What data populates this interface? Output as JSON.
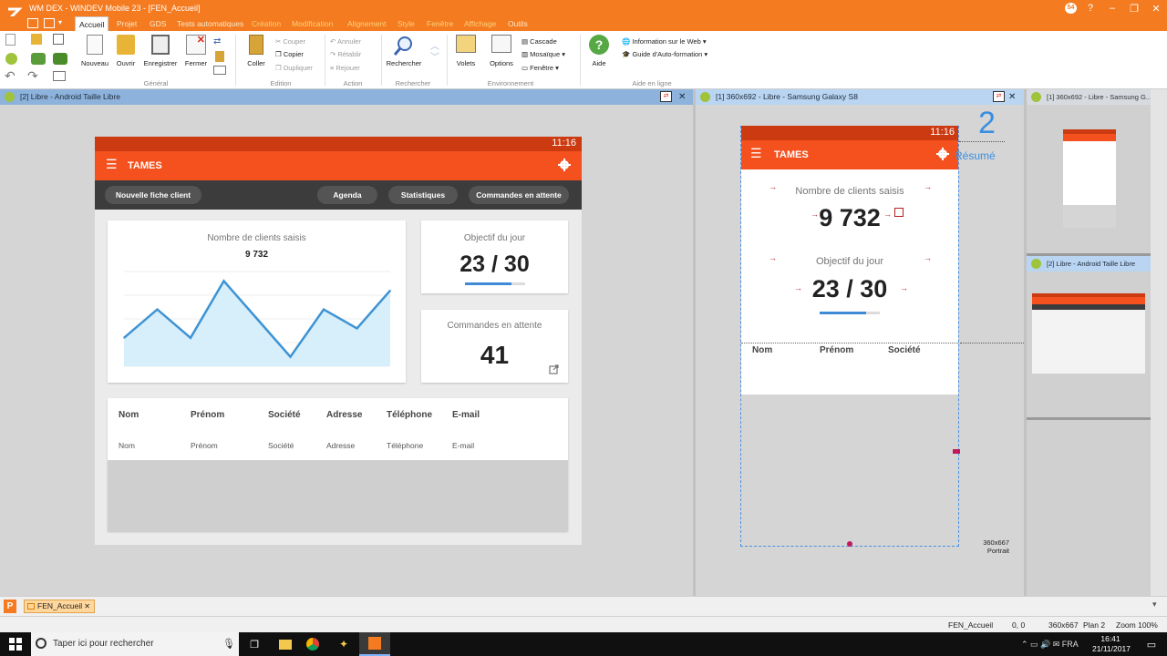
{
  "window": {
    "title": "WM DEX - WINDEV Mobile 23 - [FEN_Accueil]",
    "user_badge": "54",
    "controls": [
      "?",
      "–",
      "❐",
      "✕"
    ]
  },
  "menu_tabs": [
    "Accueil",
    "Projet",
    "GDS",
    "Tests automatiques",
    "Création",
    "Modification",
    "Alignement",
    "Style",
    "Fenêtre",
    "Affichage",
    "Outils"
  ],
  "ribbon": {
    "general": {
      "nouveau": "Nouveau",
      "ouvrir": "Ouvrir",
      "enregistrer": "Enregistrer",
      "fermer": "Fermer",
      "label": "Général"
    },
    "edition": {
      "coller": "Coller",
      "couper": "Couper",
      "copier": "Copier",
      "dupliquer": "Dupliquer",
      "label": "Edition"
    },
    "action": {
      "annuler": "Annuler",
      "retablir": "Rétablir",
      "rejouer": "Rejouer",
      "label": "Action"
    },
    "rechercher": {
      "rechercher": "Rechercher",
      "label": "Rechercher"
    },
    "environnement": {
      "volets": "Volets",
      "options": "Options",
      "cascade": "Cascade",
      "mosaique": "Mosaïque",
      "fenetre": "Fenêtre",
      "label": "Environnement"
    },
    "aide": {
      "aide": "Aide",
      "info_web": "Information sur le Web",
      "guide": "Guide d'Auto-formation",
      "label": "Aide en ligne"
    }
  },
  "panes": {
    "left_title": "[2] Libre - Android Taille Libre",
    "center_title": "[1] 360x692 - Libre - Samsung Galaxy S8",
    "thumb1_title": "[1] 360x692 - Libre - Samsung G...",
    "thumb2_title": "[2] Libre - Android Taille Libre"
  },
  "tablet": {
    "time": "11:16",
    "app_title": "TAMES",
    "buttons": {
      "new_client": "Nouvelle fiche client",
      "agenda": "Agenda",
      "stats": "Statistiques",
      "pending": "Commandes en attente"
    },
    "clients_label": "Nombre de clients saisis",
    "clients_value": "9 732",
    "goal_label": "Objectif du jour",
    "goal_value": "23 / 30",
    "goal_progress": 0.767,
    "orders_label": "Commandes en attente",
    "orders_value": "41",
    "table_headers": [
      "Nom",
      "Prénom",
      "Société",
      "Adresse",
      "Téléphone",
      "E-mail"
    ],
    "table_row": [
      "Nom",
      "Prénom",
      "Société",
      "Adresse",
      "Téléphone",
      "E-mail"
    ]
  },
  "chart_data": {
    "type": "area",
    "x": [
      1,
      2,
      3,
      4,
      5,
      6,
      7,
      8,
      9
    ],
    "values": [
      3,
      6,
      3,
      9,
      5,
      1,
      6,
      4,
      8
    ],
    "ylim": [
      0,
      10
    ],
    "color": "#3e93d3",
    "fill": "#d7eefb"
  },
  "phone": {
    "time": "11:16",
    "app_title": "TAMES",
    "resume_number": "2",
    "resume_label": "Résumé",
    "clients_label": "Nombre de clients saisis",
    "clients_value": "9 732",
    "goal_label": "Objectif du jour",
    "goal_value": "23 / 30",
    "goal_progress": 0.767,
    "table_headers": [
      "Nom",
      "Prénom",
      "Société"
    ],
    "size_label": "360x667",
    "orientation": "Portrait"
  },
  "bottom_tab": "FEN_Accueil",
  "status": {
    "window": "FEN_Accueil",
    "coords": "0, 0",
    "size": "360x667",
    "plan": "Plan 2",
    "zoom": "Zoom 100%"
  },
  "taskbar": {
    "search_placeholder": "Taper ici pour rechercher",
    "time": "16:41",
    "date": "21/11/2017"
  },
  "colors": {
    "accent": "#f47b20",
    "app_bar": "#f4511e",
    "dark_toolbar": "#3c3c3c",
    "progress": "#3e8ad6"
  }
}
